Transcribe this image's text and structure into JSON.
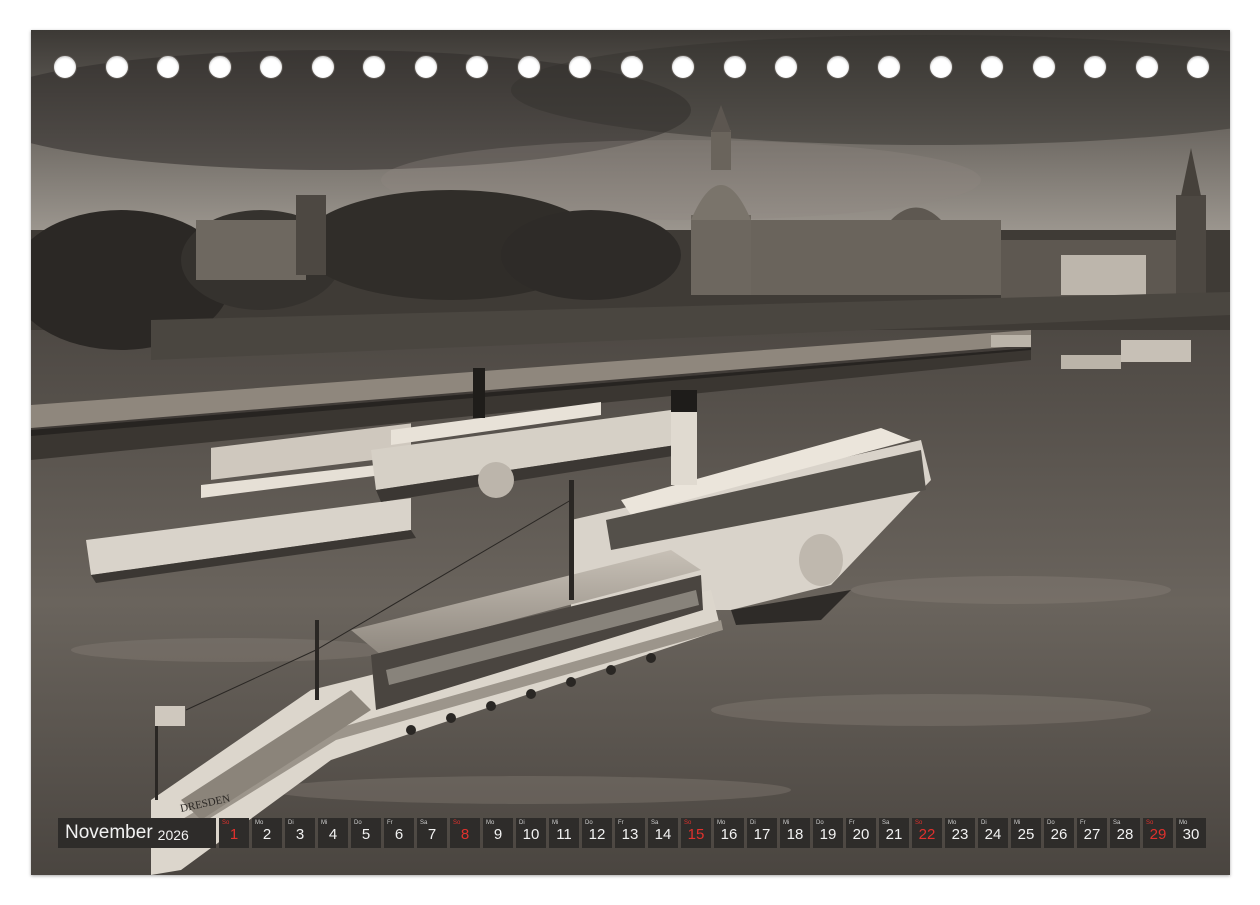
{
  "calendar": {
    "month": "November",
    "year": "2026",
    "sunday_color": "#e0312d",
    "days": [
      {
        "n": "1",
        "wd": "So",
        "sun": true
      },
      {
        "n": "2",
        "wd": "Mo",
        "sun": false
      },
      {
        "n": "3",
        "wd": "Di",
        "sun": false
      },
      {
        "n": "4",
        "wd": "Mi",
        "sun": false
      },
      {
        "n": "5",
        "wd": "Do",
        "sun": false
      },
      {
        "n": "6",
        "wd": "Fr",
        "sun": false
      },
      {
        "n": "7",
        "wd": "Sa",
        "sun": false
      },
      {
        "n": "8",
        "wd": "So",
        "sun": true
      },
      {
        "n": "9",
        "wd": "Mo",
        "sun": false
      },
      {
        "n": "10",
        "wd": "Di",
        "sun": false
      },
      {
        "n": "11",
        "wd": "Mi",
        "sun": false
      },
      {
        "n": "12",
        "wd": "Do",
        "sun": false
      },
      {
        "n": "13",
        "wd": "Fr",
        "sun": false
      },
      {
        "n": "14",
        "wd": "Sa",
        "sun": false
      },
      {
        "n": "15",
        "wd": "So",
        "sun": true
      },
      {
        "n": "16",
        "wd": "Mo",
        "sun": false
      },
      {
        "n": "17",
        "wd": "Di",
        "sun": false
      },
      {
        "n": "18",
        "wd": "Mi",
        "sun": false
      },
      {
        "n": "19",
        "wd": "Do",
        "sun": false
      },
      {
        "n": "20",
        "wd": "Fr",
        "sun": false
      },
      {
        "n": "21",
        "wd": "Sa",
        "sun": false
      },
      {
        "n": "22",
        "wd": "So",
        "sun": true
      },
      {
        "n": "23",
        "wd": "Mo",
        "sun": false
      },
      {
        "n": "24",
        "wd": "Di",
        "sun": false
      },
      {
        "n": "25",
        "wd": "Mi",
        "sun": false
      },
      {
        "n": "26",
        "wd": "Do",
        "sun": false
      },
      {
        "n": "27",
        "wd": "Fr",
        "sun": false
      },
      {
        "n": "28",
        "wd": "Sa",
        "sun": false
      },
      {
        "n": "29",
        "wd": "So",
        "sun": true
      },
      {
        "n": "30",
        "wd": "Mo",
        "sun": false
      }
    ]
  },
  "photo": {
    "boat_name": "DRESDEN"
  }
}
